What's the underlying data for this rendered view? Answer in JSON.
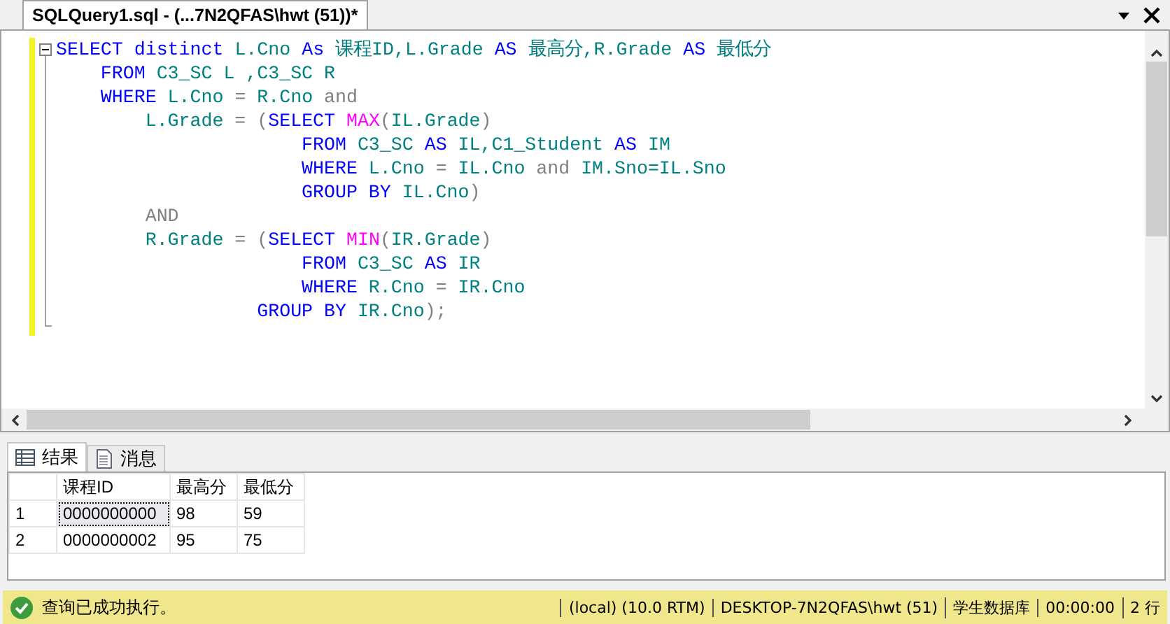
{
  "document_tab": {
    "title": "SQLQuery1.sql - (...7N2QFAS\\hwt (51))*",
    "modified": true
  },
  "code_lines": [
    [
      {
        "kind": "keyword",
        "text": "SELECT"
      },
      {
        "kind": "keyword",
        "text": " distinct"
      },
      {
        "kind": "identifier",
        "text": " L.Cno"
      },
      {
        "kind": "keyword",
        "text": " As"
      },
      {
        "kind": "identifier",
        "text": " 课程ID,L.Grade"
      },
      {
        "kind": "keyword",
        "text": " AS"
      },
      {
        "kind": "identifier",
        "text": " 最高分,R.Grade"
      },
      {
        "kind": "keyword",
        "text": " AS"
      },
      {
        "kind": "identifier",
        "text": " 最低分"
      }
    ],
    [
      {
        "kind": "keyword",
        "text": "    FROM"
      },
      {
        "kind": "identifier",
        "text": " C3_SC L ,C3_SC R"
      }
    ],
    [
      {
        "kind": "keyword",
        "text": "    WHERE"
      },
      {
        "kind": "identifier",
        "text": " L.Cno"
      },
      {
        "kind": "operator",
        "text": " ="
      },
      {
        "kind": "identifier",
        "text": " R.Cno"
      },
      {
        "kind": "operator",
        "text": " and"
      }
    ],
    [
      {
        "kind": "identifier",
        "text": "        L.Grade"
      },
      {
        "kind": "operator",
        "text": " = ("
      },
      {
        "kind": "keyword",
        "text": "SELECT"
      },
      {
        "kind": "function",
        "text": " MAX"
      },
      {
        "kind": "operator",
        "text": "("
      },
      {
        "kind": "identifier",
        "text": "IL.Grade"
      },
      {
        "kind": "operator",
        "text": ")"
      }
    ],
    [
      {
        "kind": "keyword",
        "text": "                      FROM"
      },
      {
        "kind": "identifier",
        "text": " C3_SC"
      },
      {
        "kind": "keyword",
        "text": " AS"
      },
      {
        "kind": "identifier",
        "text": " IL,C1_Student"
      },
      {
        "kind": "keyword",
        "text": " AS"
      },
      {
        "kind": "identifier",
        "text": " IM"
      }
    ],
    [
      {
        "kind": "keyword",
        "text": "                      WHERE"
      },
      {
        "kind": "identifier",
        "text": " L.Cno"
      },
      {
        "kind": "operator",
        "text": " ="
      },
      {
        "kind": "identifier",
        "text": " IL.Cno"
      },
      {
        "kind": "operator",
        "text": " and"
      },
      {
        "kind": "identifier",
        "text": " IM.Sno=IL.Sno"
      }
    ],
    [
      {
        "kind": "keyword",
        "text": "                      GROUP BY"
      },
      {
        "kind": "identifier",
        "text": " IL.Cno"
      },
      {
        "kind": "operator",
        "text": ")"
      }
    ],
    [
      {
        "kind": "operator",
        "text": "        AND"
      }
    ],
    [
      {
        "kind": "identifier",
        "text": "        R.Grade"
      },
      {
        "kind": "operator",
        "text": " = ("
      },
      {
        "kind": "keyword",
        "text": "SELECT"
      },
      {
        "kind": "function",
        "text": " MIN"
      },
      {
        "kind": "operator",
        "text": "("
      },
      {
        "kind": "identifier",
        "text": "IR.Grade"
      },
      {
        "kind": "operator",
        "text": ")"
      }
    ],
    [
      {
        "kind": "keyword",
        "text": "                      FROM"
      },
      {
        "kind": "identifier",
        "text": " C3_SC"
      },
      {
        "kind": "keyword",
        "text": " AS"
      },
      {
        "kind": "identifier",
        "text": " IR"
      }
    ],
    [
      {
        "kind": "keyword",
        "text": "                      WHERE"
      },
      {
        "kind": "identifier",
        "text": " R.Cno"
      },
      {
        "kind": "operator",
        "text": " ="
      },
      {
        "kind": "identifier",
        "text": " IR.Cno"
      }
    ],
    [
      {
        "kind": "keyword",
        "text": "                  GROUP BY"
      },
      {
        "kind": "identifier",
        "text": " IR.Cno"
      },
      {
        "kind": "operator",
        "text": ");"
      }
    ]
  ],
  "result_tabs": [
    {
      "label": "结果",
      "selected": true
    },
    {
      "label": "消息",
      "selected": false
    }
  ],
  "results": {
    "columns": [
      "课程ID",
      "最高分",
      "最低分"
    ],
    "rows": [
      {
        "num": "1",
        "cells": [
          "0000000000",
          "98",
          "59"
        ],
        "focused": true
      },
      {
        "num": "2",
        "cells": [
          "0000000002",
          "95",
          "75"
        ],
        "focused": false
      }
    ]
  },
  "status_bar": {
    "message": "查询已成功执行。",
    "fields": [
      "(local) (10.0 RTM)",
      "DESKTOP-7N2QFAS\\hwt (51)",
      "学生数据库",
      "00:00:00",
      "2 行"
    ]
  }
}
